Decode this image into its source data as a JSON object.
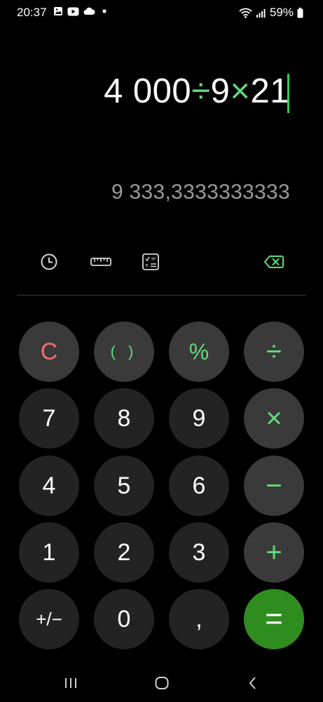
{
  "status_bar": {
    "time": "20:37",
    "left_icons": [
      "gallery-icon",
      "youtube-icon",
      "cloud-icon",
      "dot-icon"
    ],
    "right_icons": [
      "wifi-icon",
      "signal-icon",
      "battery-icon"
    ],
    "battery_percent": "59%"
  },
  "display": {
    "expression_parts": [
      {
        "text": "4 000",
        "kind": "number"
      },
      {
        "text": "÷",
        "kind": "operator"
      },
      {
        "text": "9",
        "kind": "number"
      },
      {
        "text": "×",
        "kind": "operator"
      },
      {
        "text": "21",
        "kind": "number"
      }
    ],
    "result": "9 333,3333333333"
  },
  "tools": {
    "history_icon": "clock-icon",
    "unit_converter_icon": "ruler-icon",
    "scientific_icon": "scientific-calculator-icon",
    "backspace_icon": "backspace-icon"
  },
  "keypad": {
    "row1": [
      "C",
      "( )",
      "%",
      "÷"
    ],
    "row2": [
      "7",
      "8",
      "9",
      "×"
    ],
    "row3": [
      "4",
      "5",
      "6",
      "−"
    ],
    "row4": [
      "1",
      "2",
      "3",
      "+"
    ],
    "row5": [
      "+/−",
      "0",
      ",",
      "="
    ]
  },
  "colors": {
    "background": "#000000",
    "key": "#232323",
    "function_key": "#3a3a3a",
    "accent_green": "#64dc7c",
    "clear_red": "#f06e6e",
    "equals_bg": "#2f8d1f",
    "result_gray": "#9a9a9a"
  },
  "navbar": {
    "icons": [
      "recent-apps-icon",
      "home-icon",
      "back-icon"
    ]
  }
}
